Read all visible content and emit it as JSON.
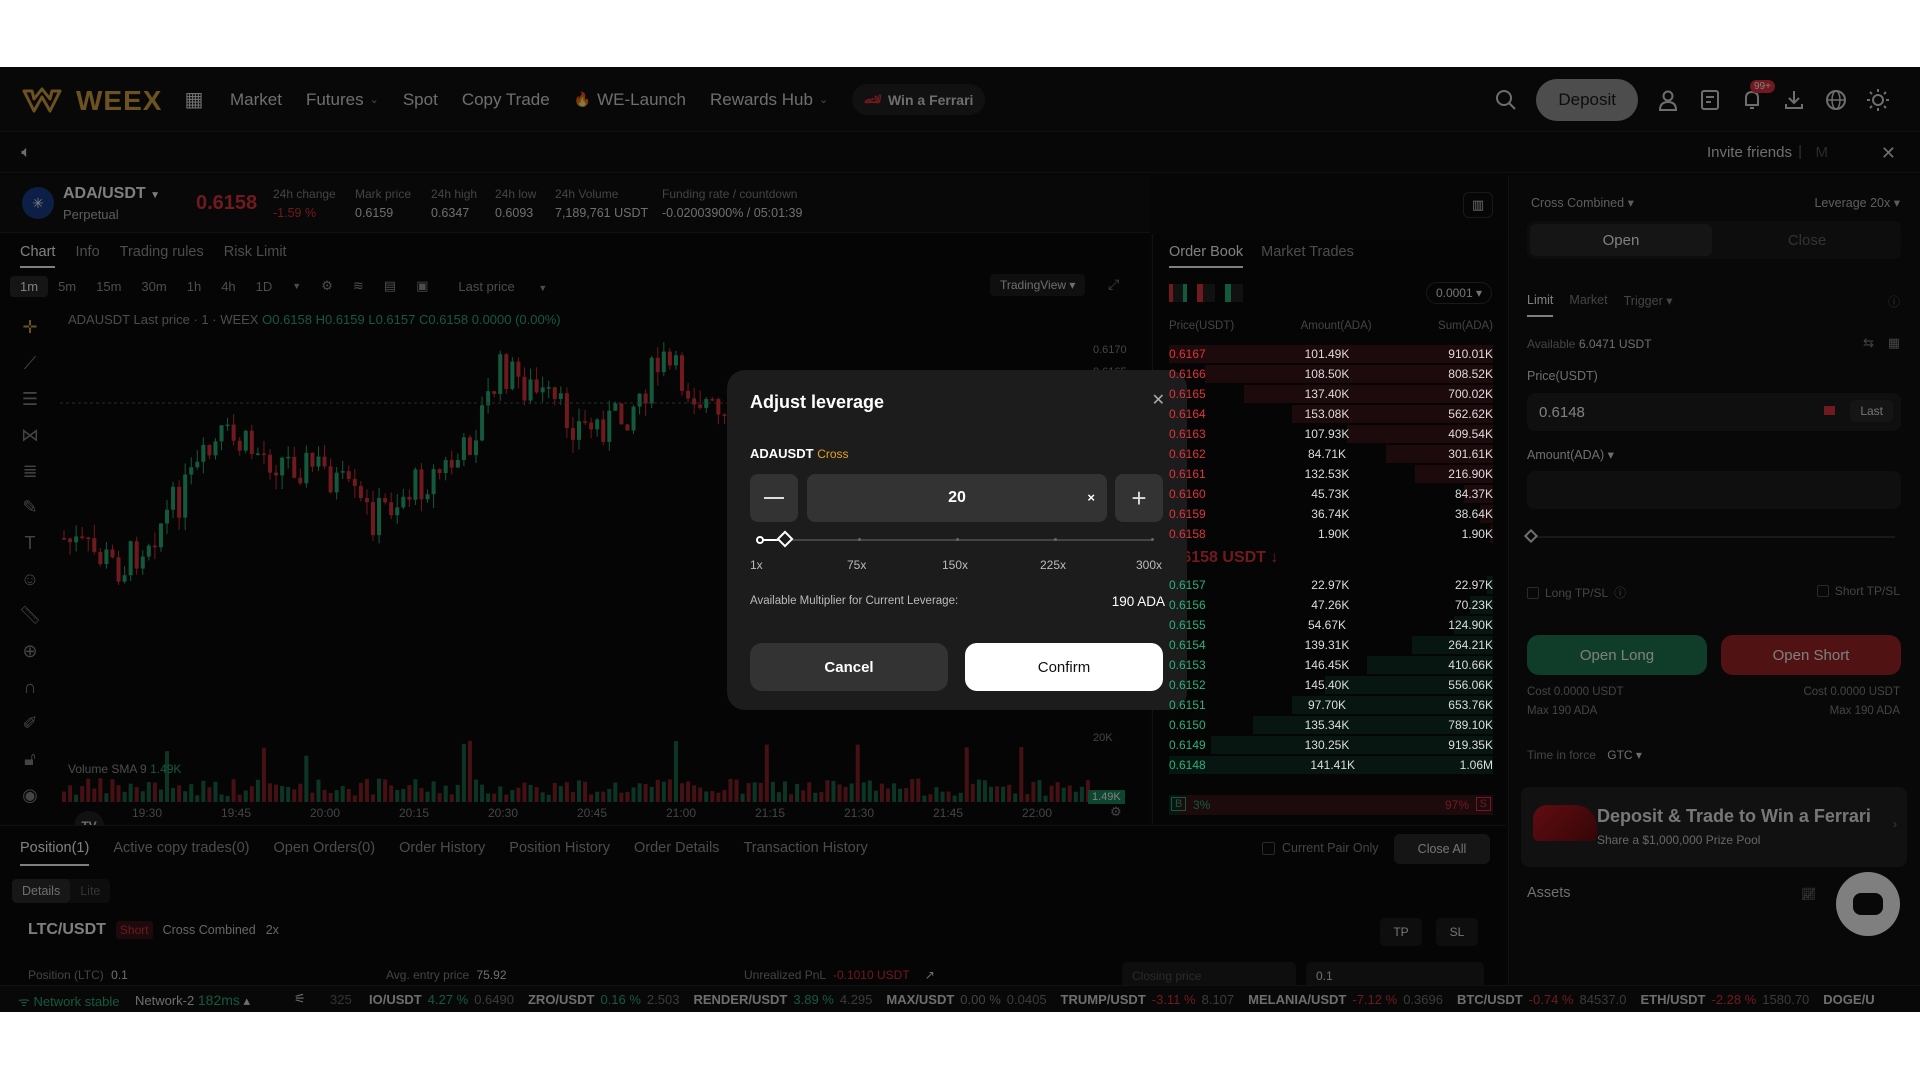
{
  "nav": {
    "logo_text": "WEEX",
    "items": [
      "Market",
      "Futures",
      "Spot",
      "Copy Trade",
      "WE-Launch",
      "Rewards Hub"
    ],
    "ferrari": "Win a Ferrari",
    "deposit": "Deposit",
    "notif_badge": "99+"
  },
  "subbar": {
    "invite": "Invite friends",
    "sep": "|",
    "m": "M"
  },
  "ticker": {
    "pair": "ADA/USDT",
    "type": "Perpetual",
    "price": "0.6158",
    "stats": [
      {
        "label": "24h change",
        "value": "-1.59 %"
      },
      {
        "label": "Mark price",
        "value": "0.6159"
      },
      {
        "label": "24h high",
        "value": "0.6347"
      },
      {
        "label": "24h low",
        "value": "0.6093"
      },
      {
        "label": "24h Volume",
        "value": "7,189,761 USDT"
      },
      {
        "label": "Funding rate / countdown",
        "value": "-0.02003900% / 05:01:39"
      }
    ]
  },
  "chart": {
    "tabs": [
      "Chart",
      "Info",
      "Trading rules",
      "Risk Limit"
    ],
    "timeframes": [
      "1m",
      "5m",
      "15m",
      "30m",
      "1h",
      "4h",
      "1D"
    ],
    "last_price": "Last price",
    "tv": "TradingView",
    "ohlc_label": "ADAUSDT Last price · 1 · WEEX",
    "ohlc_values": "O0.6158 H0.6159 L0.6157 C0.6158 0.0000 (0.00%)",
    "volume_label": "Volume SMA 9",
    "volume_value": "1.49K",
    "y_ticks": [
      "0.6170",
      "0.6165"
    ],
    "y_vol": "20K",
    "vol_last": "1.49K",
    "x_ticks": [
      "19:30",
      "19:45",
      "20:00",
      "20:15",
      "20:30",
      "20:45",
      "21:00",
      "21:15",
      "21:30",
      "21:45",
      "22:00"
    ]
  },
  "orderbook": {
    "tabs": [
      "Order Book",
      "Market Trades"
    ],
    "precision": "0.0001",
    "headers": [
      "Price(USDT)",
      "Amount(ADA)",
      "Sum(ADA)"
    ],
    "asks": [
      [
        "0.6167",
        "101.49K",
        "910.01K"
      ],
      [
        "0.6166",
        "108.50K",
        "808.52K"
      ],
      [
        "0.6165",
        "137.40K",
        "700.02K"
      ],
      [
        "0.6164",
        "153.08K",
        "562.62K"
      ],
      [
        "0.6163",
        "107.93K",
        "409.54K"
      ],
      [
        "0.6162",
        "84.71K",
        "301.61K"
      ],
      [
        "0.6161",
        "132.53K",
        "216.90K"
      ],
      [
        "0.6160",
        "45.73K",
        "84.37K"
      ],
      [
        "0.6159",
        "36.74K",
        "38.64K"
      ],
      [
        "0.6158",
        "1.90K",
        "1.90K"
      ]
    ],
    "ask_depth": [
      1.0,
      0.89,
      0.77,
      0.62,
      0.45,
      0.33,
      0.24,
      0.09,
      0.04,
      0.01
    ],
    "mid_price": "0.6158 USDT ↓",
    "bids": [
      [
        "0.6157",
        "22.97K",
        "22.97K"
      ],
      [
        "0.6156",
        "47.26K",
        "70.23K"
      ],
      [
        "0.6155",
        "54.67K",
        "124.90K"
      ],
      [
        "0.6154",
        "139.31K",
        "264.21K"
      ],
      [
        "0.6153",
        "146.45K",
        "410.66K"
      ],
      [
        "0.6152",
        "145.40K",
        "556.06K"
      ],
      [
        "0.6151",
        "97.70K",
        "653.76K"
      ],
      [
        "0.6150",
        "135.34K",
        "789.10K"
      ],
      [
        "0.6149",
        "130.25K",
        "919.35K"
      ],
      [
        "0.6148",
        "141.41K",
        "1.06M"
      ]
    ],
    "bid_depth": [
      0.02,
      0.07,
      0.12,
      0.25,
      0.39,
      0.52,
      0.62,
      0.74,
      0.87,
      1.0
    ],
    "buy_pct": "3%",
    "sell_pct": "97%",
    "buy_label": "B",
    "sell_label": "S"
  },
  "trade": {
    "margin_mode": "Cross Combined",
    "leverage": "Leverage 20x",
    "open": "Open",
    "close": "Close",
    "order_types": [
      "Limit",
      "Market",
      "Trigger"
    ],
    "available_label": "Available",
    "available_value": "6.0471 USDT",
    "price_label": "Price(USDT)",
    "price_value": "0.6148",
    "last_btn": "Last",
    "amount_label": "Amount(ADA)",
    "long_tpsl": "Long TP/SL",
    "short_tpsl": "Short TP/SL",
    "open_long": "Open Long",
    "open_short": "Open Short",
    "cost_long": "Cost 0.0000 USDT",
    "cost_short": "Cost 0.0000 USDT",
    "max_long": "Max 190 ADA",
    "max_short": "Max 190 ADA",
    "tif_label": "Time in force",
    "tif_value": "GTC",
    "promo_title": "Deposit & Trade to Win a Ferrari",
    "promo_sub": "Share a $1,000,000 Prize Pool",
    "assets": "Assets"
  },
  "positions": {
    "tabs": [
      "Position(1)",
      "Active copy trades(0)",
      "Open Orders(0)",
      "Order History",
      "Position History",
      "Order Details",
      "Transaction History"
    ],
    "current_pair_only": "Current Pair Only",
    "close_all": "Close All",
    "view_tabs": [
      "Details",
      "Lite"
    ],
    "pair": "LTC/USDT",
    "side": "Short",
    "mode": "Cross Combined",
    "lev": "2x",
    "tp": "TP",
    "sl": "SL",
    "pos_label": "Position (LTC)",
    "pos_value": "0.1",
    "entry_label": "Avg. entry price",
    "entry_value": "75.92",
    "pnl_label": "Unrealized PnL",
    "pnl_value": "-0.1010 USDT",
    "closing_price": "Closing price",
    "qty": "0.1"
  },
  "footer": {
    "network": "Network stable",
    "net2": "Network-2",
    "latency": "182ms",
    "count": "325",
    "tickers": [
      {
        "pair": "IO/USDT",
        "chg": "4.27 %",
        "price": "0.6490",
        "up": true
      },
      {
        "pair": "ZRO/USDT",
        "chg": "0.16 %",
        "price": "2.503",
        "up": true
      },
      {
        "pair": "RENDER/USDT",
        "chg": "3.89 %",
        "price": "4.295",
        "up": true
      },
      {
        "pair": "MAX/USDT",
        "chg": "0.00 %",
        "price": "0.0405",
        "up": null
      },
      {
        "pair": "TRUMP/USDT",
        "chg": "-3.11 %",
        "price": "8.107",
        "up": false
      },
      {
        "pair": "MELANIA/USDT",
        "chg": "-7.12 %",
        "price": "0.3696",
        "up": false
      },
      {
        "pair": "BTC/USDT",
        "chg": "-0.74 %",
        "price": "84537.0",
        "up": false
      },
      {
        "pair": "ETH/USDT",
        "chg": "-2.28 %",
        "price": "1580.70",
        "up": false
      },
      {
        "pair": "DOGE/U",
        "chg": "",
        "price": "",
        "up": null
      }
    ]
  },
  "modal": {
    "title": "Adjust leverage",
    "symbol": "ADAUSDT",
    "mode": "Cross",
    "value": "20",
    "slider_fraction": 0.0635,
    "marks": [
      "1x",
      "75x",
      "150x",
      "225x",
      "300x"
    ],
    "available_label": "Available Multiplier for Current Leverage:",
    "available_value": "190 ADA",
    "cancel": "Cancel",
    "confirm": "Confirm"
  },
  "colors": {
    "up": "#2ab27b",
    "down": "#e0333d",
    "accent": "#d9a441",
    "cross": "#e3a21a"
  }
}
